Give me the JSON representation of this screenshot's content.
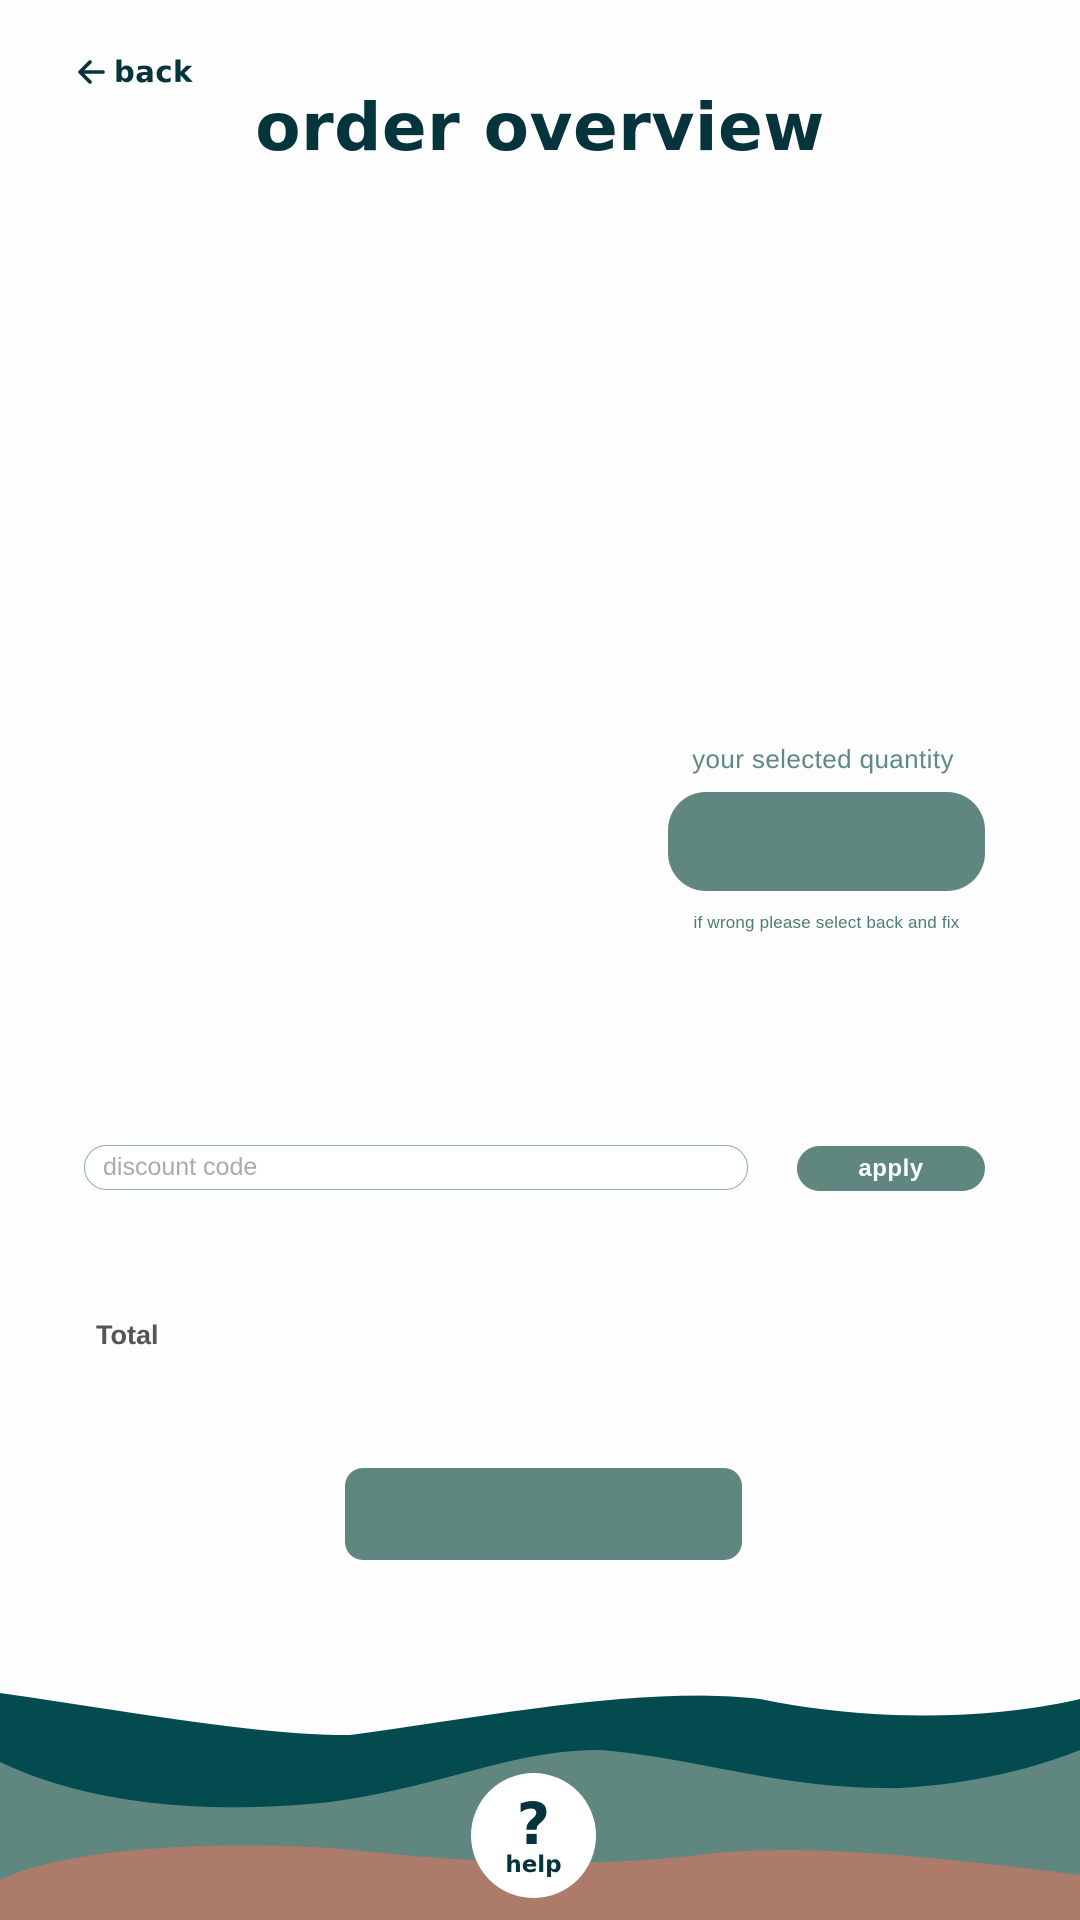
{
  "header": {
    "back_label": "back",
    "back_icon": "arrow-left-icon",
    "title": "order overview"
  },
  "quantity": {
    "label": "your selected quantity",
    "value": "",
    "hint": "if wrong please select back and fix"
  },
  "discount": {
    "placeholder": "discount code",
    "value": "",
    "apply_label": "apply"
  },
  "total": {
    "label": "Total",
    "value": ""
  },
  "confirm": {
    "label": ""
  },
  "help": {
    "icon": "question-mark-icon",
    "label": "help"
  },
  "colors": {
    "title": "#06343c",
    "accent": "#5f8780",
    "wave_dark": "#044b50",
    "wave_mid": "#5f8780",
    "wave_terracotta": "#ac7b6a"
  }
}
